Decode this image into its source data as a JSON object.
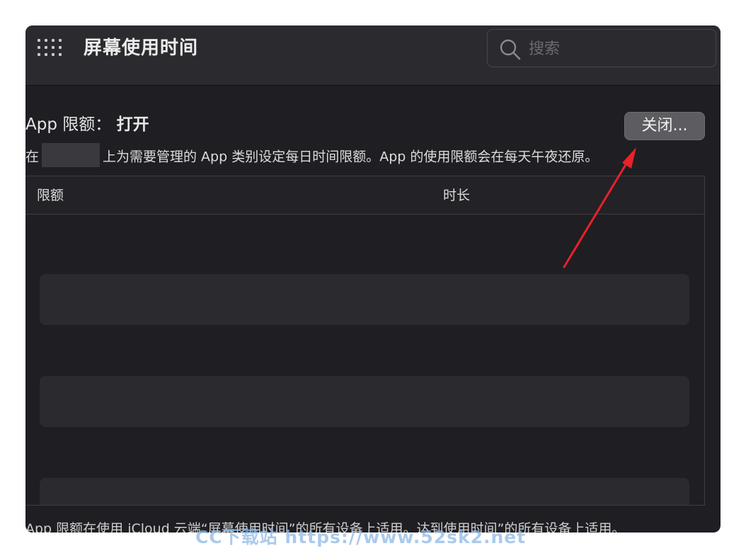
{
  "window": {
    "title": "屏幕使用时间",
    "search_placeholder": "搜索"
  },
  "limits": {
    "status_label": "App 限额：",
    "status_value": "打开",
    "close_button": "关闭...",
    "description_start": "在",
    "description_end": "上为需要管理的 App 类别设定每日时间限额。App 的使用限额会在每天午夜还原。"
  },
  "table": {
    "columns": [
      "限额",
      "时长"
    ],
    "rows": []
  },
  "footer_note": "App 限额在使用 iCloud 云端“屏幕使用时间”的所有设备上适用。达到使用时间”的所有设备上适用。",
  "watermark": "CC下载站 https://www.52sk2.net",
  "colors": {
    "annotation_arrow": "#e8212a",
    "window_bg": "#1f1e22"
  }
}
